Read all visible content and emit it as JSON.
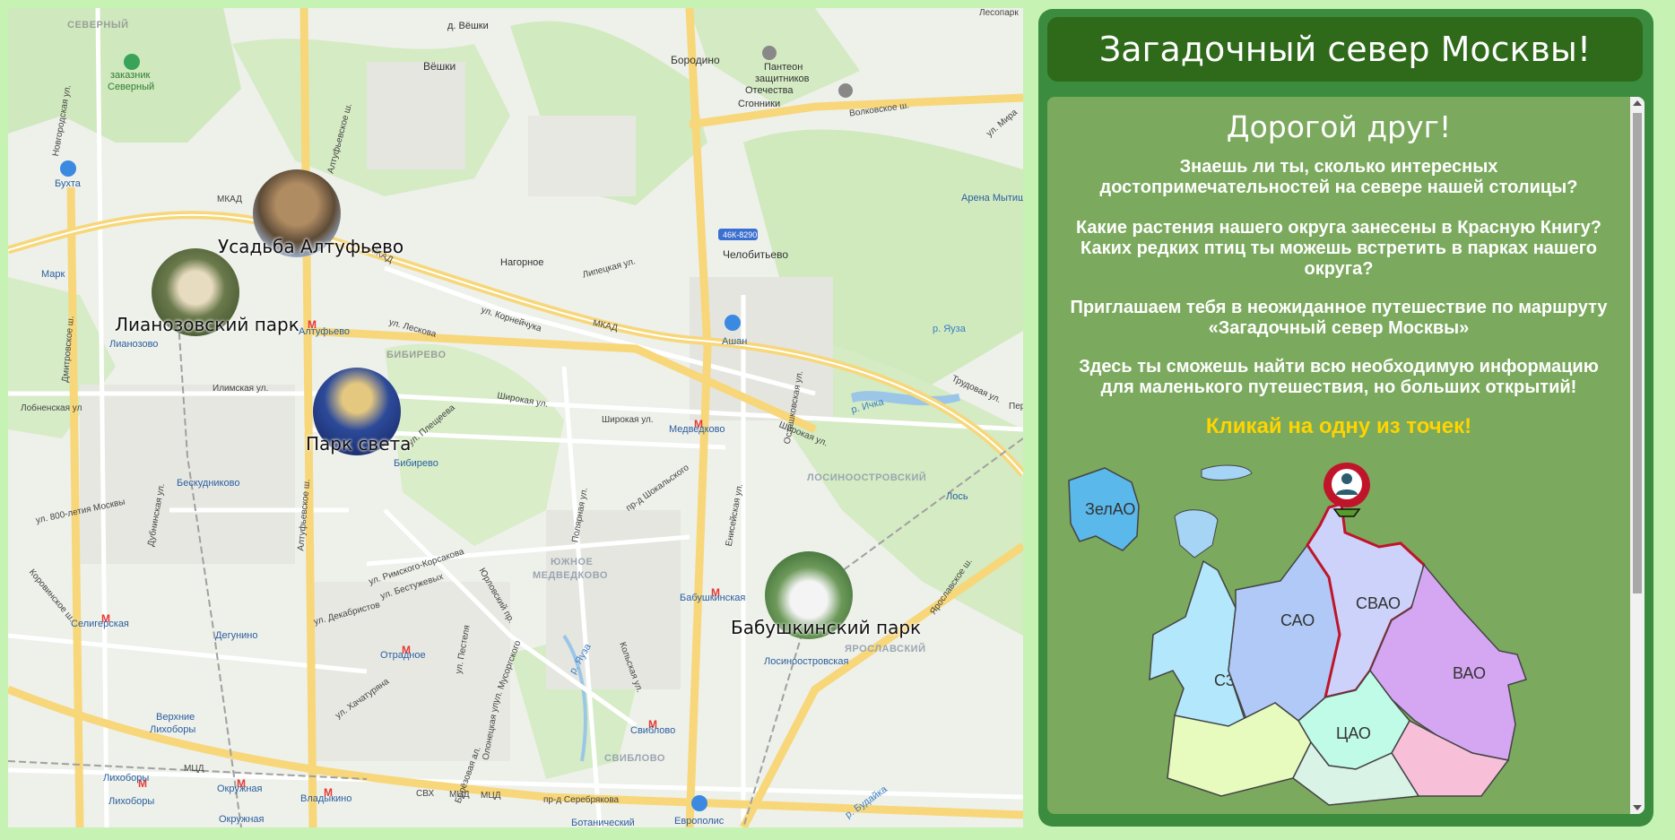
{
  "map": {
    "markers": [
      {
        "label": "Усадьба Алтуфьево"
      },
      {
        "label": "Лианозовский парк"
      },
      {
        "label": "Парк света"
      },
      {
        "label": "Бабушкинский парк"
      }
    ],
    "labels": {
      "severny": "СЕВЕРНЫЙ",
      "zakaznik": "заказник",
      "severny2": "Северный",
      "veshki_d": "д. Вёшки",
      "veshki": "Вёшки",
      "borodino": "Бородино",
      "panteon1": "Пантеон",
      "panteon2": "защитников",
      "panteon3": "Отечества",
      "sgonniki": "Сгонники",
      "bukhta": "Бухта",
      "mkad1": "МКАД",
      "mkad2": "МКАД",
      "mkad3": "МКАД",
      "road_46k": "46К-8290",
      "nagornoe": "Нагорное",
      "chelobitevo": "Челобитьево",
      "arena": "Арена Мытищ",
      "mark": "Марк",
      "altufyevo": "Алтуфьево",
      "lianozovo": "Лианозово",
      "bibirevo_d": "БИБИРЕВО",
      "ashan": "Ашан",
      "medvedkovo": "Медведково",
      "bibirevo": "Бибирево",
      "beskudnikovo": "Бескудниково",
      "losinoostrovsky": "ЛОСИНООСТРОВСКИЙ",
      "los": "Лось",
      "yuzhnoe1": "ЮЖНОЕ",
      "yuzhnoe2": "МЕДВЕДКОВО",
      "babushkinskaya": "Бабушкинская",
      "seligerskaya": "Селигерская",
      "degunino": "Дегунино",
      "otradnoe": "Отрадное",
      "yaroslavsky": "ЯРОСЛАВСКИЙ",
      "losinoostrovskaya": "Лосиноостровская",
      "verkhnie1": "Верхние",
      "verkhnie2": "Лихоборы",
      "sviblovo": "Свиблово",
      "sviblovo_d": "СВИБЛОВО",
      "likhobory": "Лихоборы",
      "likhobory2": "Лихоборы",
      "mtsd": "МЦД",
      "okruzhnaya": "Окружная",
      "okruzhnaya2": "Окружная",
      "vladykino": "Владыкино",
      "svkh": "СВХ",
      "mtsd2": "МЦД",
      "mtsd3": "МЦД",
      "serebryakova": "пр-д Серебрякова",
      "evropolis": "Европолис",
      "botanichesky": "Ботанический",
      "ilimskaya": "Илимская ул.",
      "lobnenskaya": "Лобненская ул",
      "shirokaya": "Широкая ул.",
      "shirokaya2": "Широкая ул.",
      "shirokaya3": "Широкая ул.",
      "plescheeva": "ул. Плещеева",
      "korneychuka": "ул. Корнейчука",
      "leskova": "ул. Лескова",
      "volkovskoe": "Волковское ш.",
      "ichka": "р. Ичка",
      "yauza": "р. Яуза",
      "yauza2": "р. Яуза",
      "altufyevskoe": "Алтуфьевское ш.",
      "altufyevskoe2": "Алтуфьевское ш.",
      "dmitrovskoe": "Дмитровское ш.",
      "enisejskaya": "Енисейская ул.",
      "ostashkovskaya": "Осташковская ул.",
      "yaroslavskoe": "Ярославское ш.",
      "trudovaya": "Трудовая ул.",
      "rimskogo": "ул. Римского-Корсакова",
      "bestuzhevykh": "ул. Бестужевых",
      "dekabristov": "ул. Декабристов",
      "khachaturyana": "ул. Хачатуряна",
      "dubninskaya": "Дубнинская ул.",
      "korovinskoe": "Коровинское ш.",
      "s800": "ул. 800-летия Москвы",
      "yurlovsky": "Юрловский пр.",
      "kolskaya": "Кольская ул.",
      "polyarnaya": "Полярная ул.",
      "shokalskogo": "пр-д Шокальского",
      "novgorodskaya": "Новгородская ул.",
      "mira": "ул. Мира",
      "lesopark": "Лесопарк",
      "per": "Пер",
      "budaika": "р. Будайка",
      "pestelya": "ул. Пестеля",
      "musorgskogo": "ул. Мусоргского",
      "berezovaya": "Берёзовая ал.",
      "olonetskaya": "Олонецкая ул.",
      "lipetskaya": "Липецкая ул."
    }
  },
  "panel": {
    "title": "Загадочный север Москвы!",
    "greeting": "Дорогой друг!",
    "paragraphs": [
      "Знаешь ли ты, сколько интересных достопримечательностей на севере нашей столицы?",
      "Какие растения нашего округа занесены в Красную Книгу? Каких редких птиц ты можешь встретить в парках нашего округа?",
      "Приглашаем тебя в неожиданное путешествие по маршруту «Загадочный север Москвы»",
      "Здесь ты сможешь найти всю необходимую информацию для маленького путешествия, но больших открытий!"
    ],
    "cta": "Кликай на одну из точек!",
    "districts": {
      "zelao": "ЗелАО",
      "sao": "САО",
      "svao": "СВАО",
      "szao": "СЗАО",
      "vao": "ВАО",
      "cao": "ЦАО"
    },
    "colors": {
      "panel": "#3b8c3e",
      "title_bar": "#2e6a1a",
      "content": "#7ba95d",
      "cta": "#ffd400",
      "svao_border": "#c0142b"
    }
  }
}
